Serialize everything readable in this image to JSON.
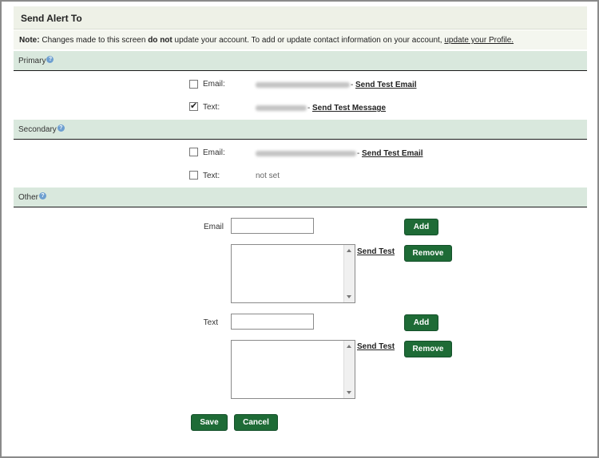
{
  "header": {
    "title": "Send Alert To"
  },
  "note": {
    "prefix": "Note:",
    "before_bold": " Changes made to this screen ",
    "bold": "do not",
    "after_bold": " update your account. To add or update contact information on your account, ",
    "link": "update your Profile."
  },
  "primary": {
    "section_label": "Primary",
    "email_label": "Email:",
    "email_test_link": "Send Test Email",
    "text_label": "Text:",
    "text_test_link": "Send Test Message",
    "email_checked": false,
    "text_checked": true
  },
  "secondary": {
    "section_label": "Secondary",
    "email_label": "Email:",
    "email_test_link": "Send Test Email",
    "text_label": "Text:",
    "text_value": "not set",
    "email_checked": false,
    "text_checked": false
  },
  "other": {
    "section_label": "Other",
    "email_label": "Email",
    "text_label": "Text",
    "add_label": "Add",
    "remove_label": "Remove",
    "send_test_label": "Send Test"
  },
  "actions": {
    "save": "Save",
    "cancel": "Cancel"
  },
  "separator": "-",
  "help_glyph": "?",
  "colors": {
    "button_green": "#1e6b36",
    "section_bg": "#d9e8dd",
    "header_bg": "#eef1e7"
  }
}
